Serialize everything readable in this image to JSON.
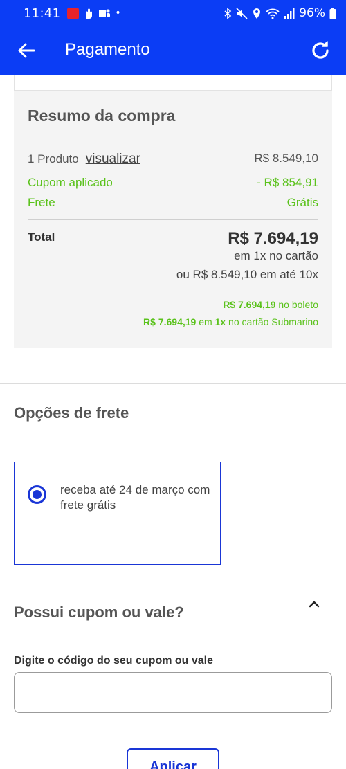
{
  "status_bar": {
    "time": "11:41",
    "battery": "96%",
    "dot": "•"
  },
  "app_bar": {
    "title": "Pagamento"
  },
  "summary": {
    "title": "Resumo da compra",
    "product_count": "1 Produto",
    "view_link": "visualizar",
    "product_price": "R$ 8.549,10",
    "coupon_label": "Cupom aplicado",
    "coupon_value": "- R$ 854,91",
    "shipping_label": "Frete",
    "shipping_value": "Grátis",
    "total_label": "Total",
    "total_value": "R$ 7.694,19",
    "card_note": "em 1x no cartão",
    "installments": "ou R$ 8.549,10 em até 10x",
    "boleto_price": "R$ 7.694,19",
    "boleto_text": "no boleto",
    "store_card_price": "R$ 7.694,19",
    "store_card_em": "em",
    "store_card_times": "1x",
    "store_card_text": "no cartão Submarino"
  },
  "shipping_options": {
    "title": "Opções de frete",
    "option_text": "receba até 24 de março com frete grátis"
  },
  "coupon": {
    "title": "Possui cupom ou vale?",
    "field_label": "Digite o código do seu cupom ou vale",
    "input_value": "",
    "apply_label": "Aplicar"
  },
  "colors": {
    "brand_blue": "#0b3df5",
    "accent_blue": "#1a36d6",
    "green": "#5ac21b"
  }
}
